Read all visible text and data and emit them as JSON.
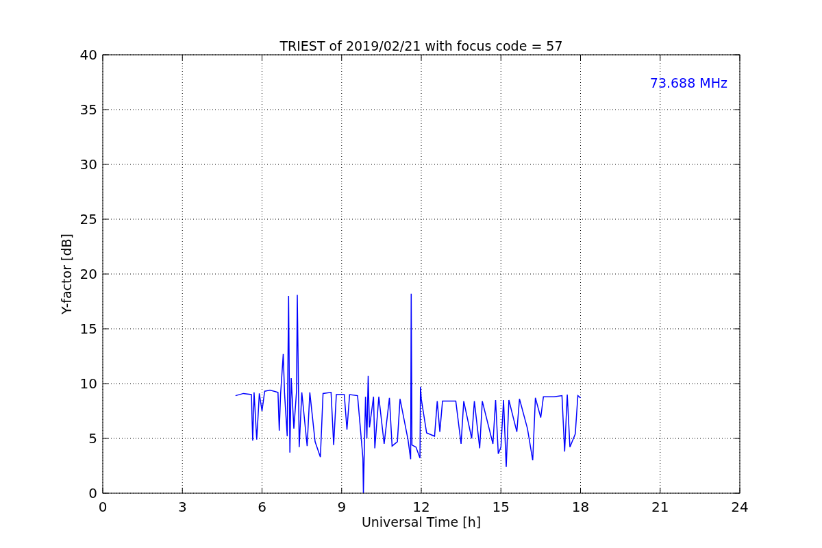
{
  "chart_data": {
    "type": "line",
    "title": "TRIEST of 2019/02/21 with focus code = 57",
    "xlabel": "Universal Time [h]",
    "ylabel": "Y-factor [dB]",
    "xlim": [
      0,
      24
    ],
    "ylim": [
      0,
      40
    ],
    "xticks": [
      0,
      3,
      6,
      9,
      12,
      15,
      18,
      21,
      24
    ],
    "yticks": [
      0,
      5,
      10,
      15,
      20,
      25,
      30,
      35,
      40
    ],
    "x": [
      5.0,
      5.3,
      5.6,
      5.65,
      5.7,
      5.8,
      5.9,
      6.0,
      6.1,
      6.3,
      6.6,
      6.65,
      6.7,
      6.8,
      6.85,
      6.95,
      7.0,
      7.05,
      7.1,
      7.2,
      7.3,
      7.33,
      7.4,
      7.5,
      7.7,
      7.8,
      8.0,
      8.2,
      8.3,
      8.6,
      8.7,
      8.8,
      9.1,
      9.2,
      9.3,
      9.6,
      9.8,
      9.82,
      9.9,
      9.95,
      10.0,
      10.05,
      10.2,
      10.25,
      10.4,
      10.6,
      10.8,
      10.9,
      11.1,
      11.2,
      11.5,
      11.6,
      11.62,
      11.65,
      11.8,
      11.95,
      11.97,
      12.0,
      12.2,
      12.5,
      12.6,
      12.7,
      12.8,
      13.3,
      13.5,
      13.6,
      13.9,
      14.0,
      14.2,
      14.3,
      14.7,
      14.8,
      14.9,
      15.0,
      15.1,
      15.2,
      15.3,
      15.6,
      15.7,
      16.0,
      16.2,
      16.3,
      16.5,
      16.6,
      17.0,
      17.3,
      17.4,
      17.5,
      17.6,
      17.8,
      17.9,
      18.0
    ],
    "series": [
      {
        "color": "#0000ff",
        "values": [
          8.9,
          9.1,
          9.0,
          4.8,
          9.2,
          4.9,
          9.1,
          7.5,
          9.3,
          9.4,
          9.2,
          5.7,
          9.0,
          12.7,
          9.1,
          5.2,
          18.0,
          3.7,
          10.5,
          5.9,
          9.3,
          18.1,
          4.2,
          9.2,
          4.3,
          9.2,
          4.7,
          3.3,
          9.1,
          9.2,
          4.4,
          9.0,
          9.0,
          5.8,
          9.0,
          8.9,
          3.2,
          0.0,
          8.8,
          5.0,
          10.7,
          6.0,
          8.8,
          4.1,
          8.8,
          4.5,
          8.7,
          4.3,
          4.7,
          8.6,
          4.9,
          3.1,
          18.2,
          4.4,
          4.2,
          3.2,
          9.7,
          8.6,
          5.5,
          5.2,
          8.4,
          5.6,
          8.4,
          8.4,
          4.5,
          8.4,
          5.0,
          8.4,
          4.1,
          8.4,
          4.5,
          8.5,
          3.6,
          4.2,
          8.5,
          2.4,
          8.5,
          5.6,
          8.6,
          5.9,
          3.0,
          8.7,
          6.9,
          8.8,
          8.8,
          8.9,
          3.8,
          9.0,
          4.2,
          5.4,
          8.9,
          8.7
        ]
      }
    ],
    "grid": true,
    "annotations": [
      {
        "text": "73.688 MHz"
      }
    ]
  }
}
